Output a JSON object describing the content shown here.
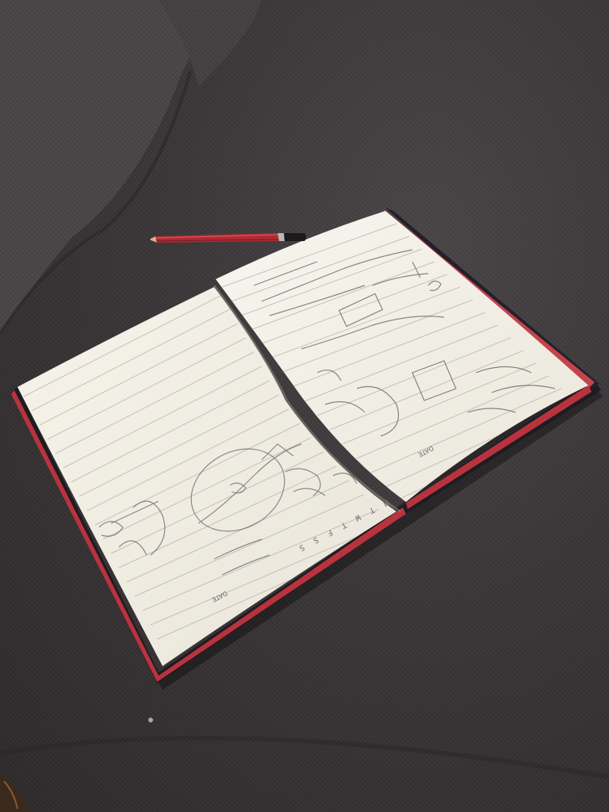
{
  "scene": {
    "description_colors": {
      "couch": "#3b3739",
      "paper": "#f2efe6",
      "page_edge": "#b8333d",
      "cover": "#1e1c22",
      "pencil_body": "#b02a33"
    }
  },
  "notebook": {
    "left_page": {
      "day_letters": "M T W T F S S",
      "date_label": "DATE"
    },
    "right_page": {
      "date_label": "DATE"
    }
  }
}
